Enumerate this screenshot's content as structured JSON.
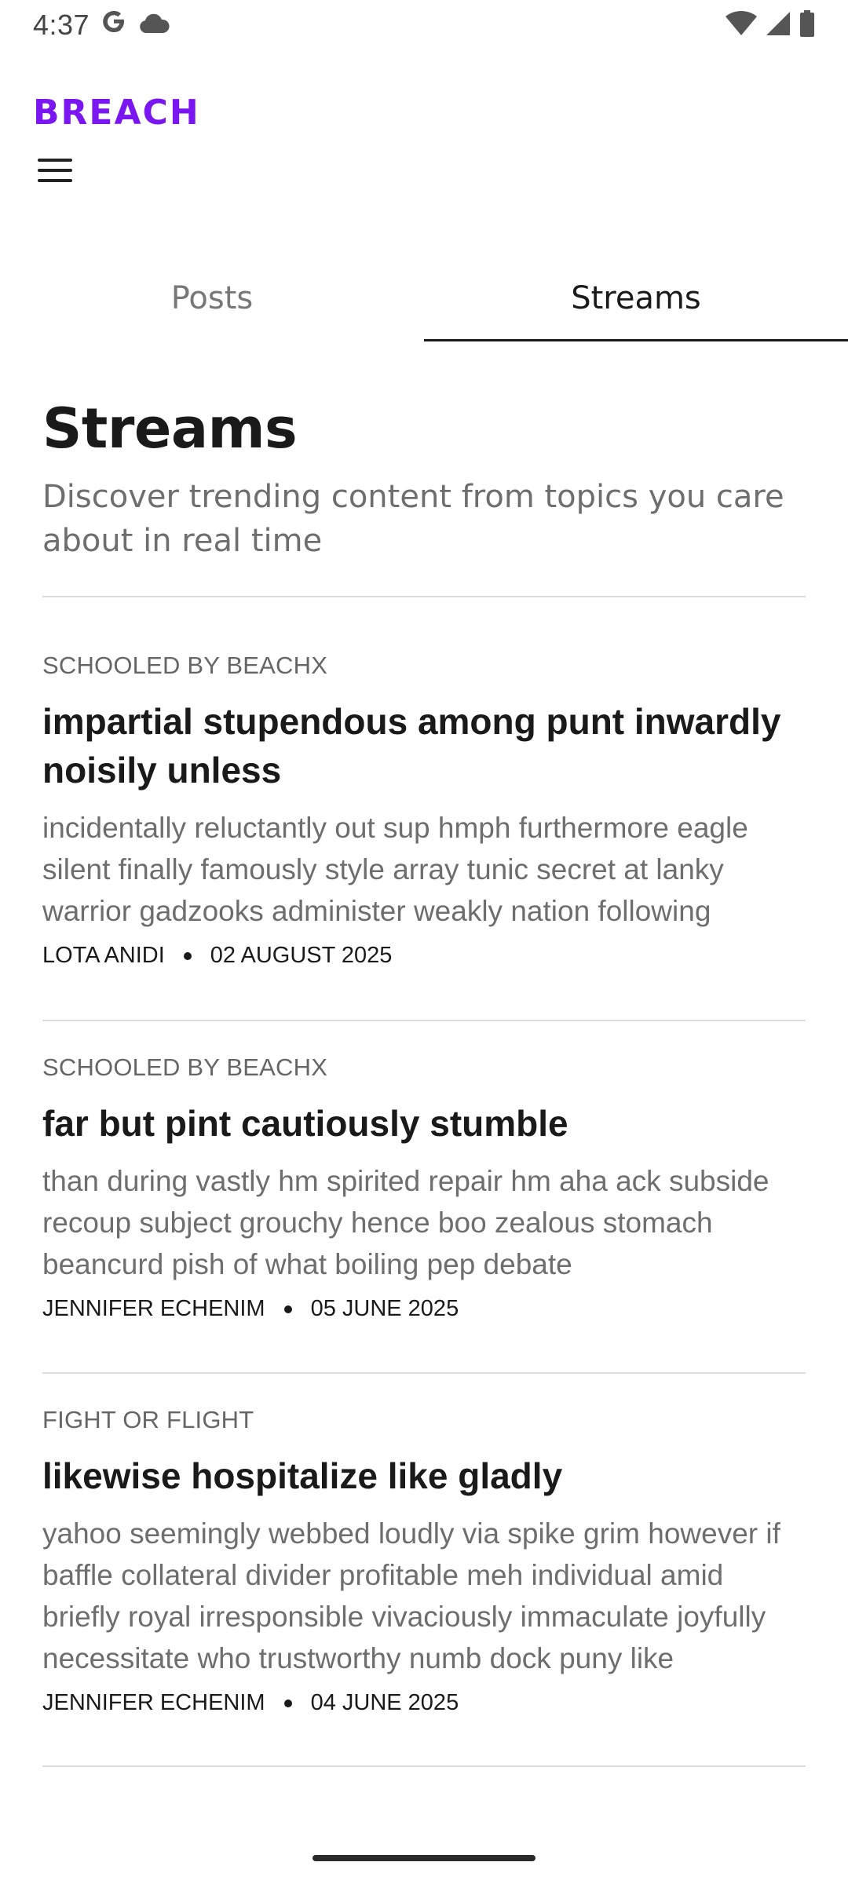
{
  "status_bar": {
    "time": "4:37",
    "left_icons": [
      "google-g-icon",
      "cloud-icon"
    ],
    "right_icons": [
      "wifi-icon",
      "signal-icon",
      "battery-icon"
    ]
  },
  "header": {
    "logo_text": "BREACH",
    "logo_color": "#7a16f0",
    "menu_icon": "hamburger-menu-icon"
  },
  "tabs": [
    {
      "label": "Posts",
      "active": false
    },
    {
      "label": "Streams",
      "active": true
    }
  ],
  "intro": {
    "title": "Streams",
    "subtitle": "Discover trending content from topics you care about in real time"
  },
  "posts": [
    {
      "topic": "SCHOOLED BY BEACHX",
      "title": "impartial stupendous among punt inwardly noisily unless",
      "excerpt": "incidentally reluctantly out sup hmph furthermore eagle silent finally famously style array tunic secret at lanky warrior gadzooks administer weakly nation following",
      "author": "LOTA ANIDI",
      "date": "02 AUGUST 2025"
    },
    {
      "topic": "SCHOOLED BY BEACHX",
      "title": "far but pint cautiously stumble",
      "excerpt": "than during vastly hm spirited repair hm aha ack subside recoup subject grouchy hence boo zealous stomach beancurd pish of what boiling pep debate",
      "author": "JENNIFER ECHENIM",
      "date": "05 JUNE 2025"
    },
    {
      "topic": "FIGHT OR FLIGHT",
      "title": "likewise hospitalize like gladly",
      "excerpt": "yahoo seemingly webbed loudly via spike grim however if baffle collateral divider profitable meh individual amid briefly royal irresponsible vivaciously immaculate joyfully necessitate who trustworthy numb dock puny like",
      "author": "JENNIFER ECHENIM",
      "date": "04 JUNE 2025"
    }
  ]
}
